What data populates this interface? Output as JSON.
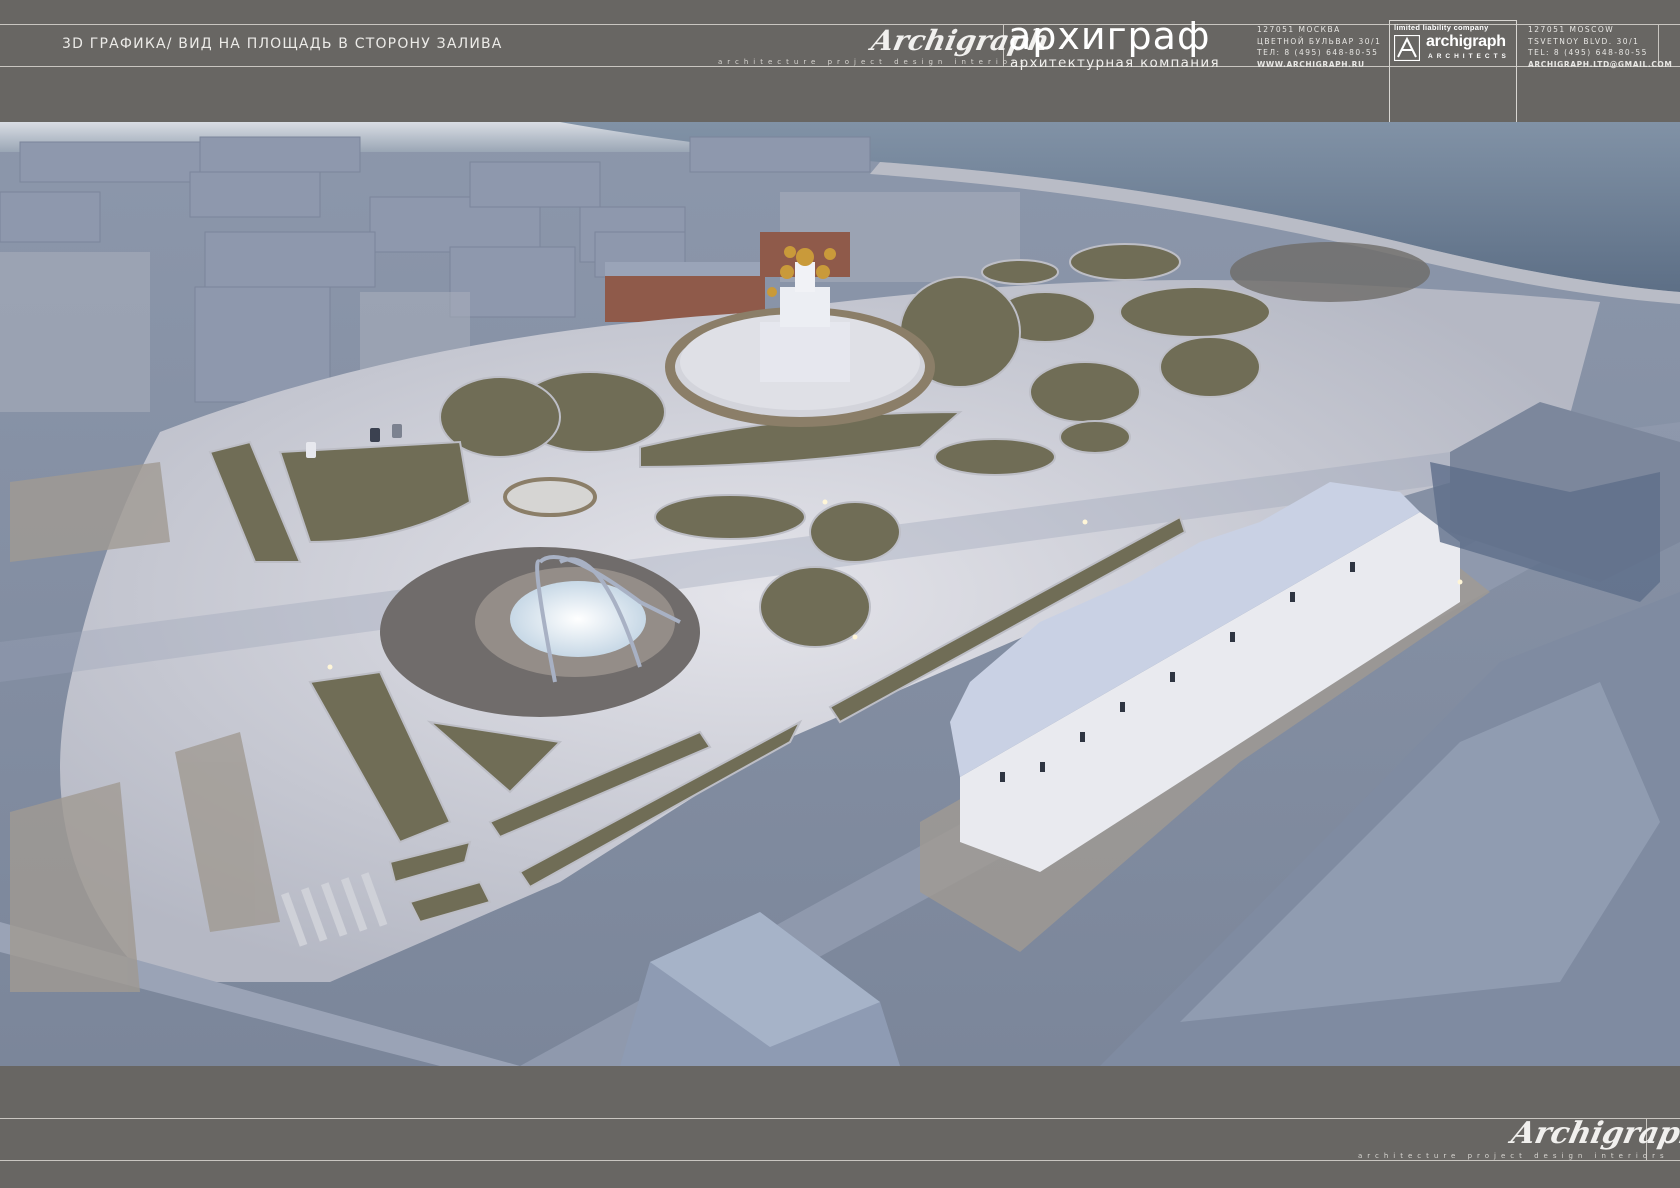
{
  "sheet": {
    "title": "3D ГРАФИКА/ ВИД НА ПЛОЩАДЬ В СТОРОНУ ЗАЛИВА"
  },
  "brand": {
    "signature": "Archigraph",
    "tagline": "architecture project design interiors",
    "name_ru": "архиграф",
    "subtitle_ru": "архитектурная компания",
    "address_ru": {
      "line1": "127051 МОСКВА",
      "line2": "ЦВЕТНОЙ БУЛЬВАР 30/1",
      "line3": "ТЕЛ: 8 (495) 648-80-55",
      "line4": "WWW.ARCHIGRAPH.RU"
    },
    "logo": {
      "llc": "limited liability company",
      "word": "archigraph",
      "architects": "ARCHITECTS"
    },
    "address_en": {
      "line1": "127051 MOSCOW",
      "line2": "TSVETNOY BLVD. 30/1",
      "line3": "TEL: 8 (495) 648-80-55",
      "line4": "ARCHIGRAPH.LTD@GMAIL.COM"
    }
  },
  "footer": {
    "signature": "Archigraph",
    "tagline": "architecture project design interiors"
  },
  "colors": {
    "frame": "#686663",
    "water": "#6f8399",
    "plaza": "#c6c7cf",
    "greenery": "#6f6e58",
    "buildings": "#8a93a6"
  }
}
